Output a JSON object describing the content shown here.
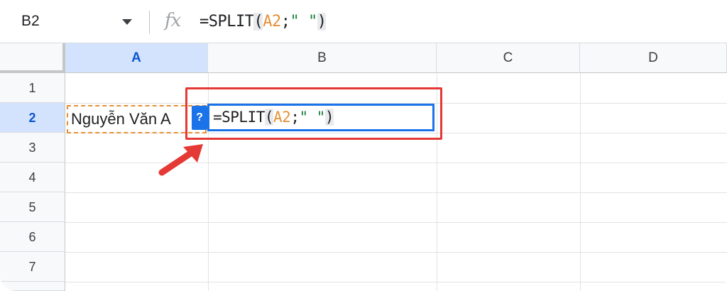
{
  "formula_bar": {
    "name_box": "B2",
    "fx_label": "fx",
    "formula_tokens": [
      {
        "text": "=SPLIT",
        "kind": "default"
      },
      {
        "text": "(",
        "kind": "paren"
      },
      {
        "text": "A2",
        "kind": "ref"
      },
      {
        "text": ";",
        "kind": "default"
      },
      {
        "text": "\" \"",
        "kind": "str"
      },
      {
        "text": ")",
        "kind": "paren"
      }
    ]
  },
  "grid": {
    "columns": [
      "A",
      "B",
      "C",
      "D"
    ],
    "selected_column": "A",
    "rows": [
      "1",
      "2",
      "3",
      "4",
      "5",
      "6",
      "7"
    ],
    "selected_row": "2",
    "cells": {
      "A2": "Nguyễn Văn A"
    }
  },
  "editor": {
    "help_badge": "?",
    "formula_tokens": [
      {
        "text": "=SPLIT",
        "kind": "default"
      },
      {
        "text": "(",
        "kind": "paren"
      },
      {
        "text": "A2",
        "kind": "ref"
      },
      {
        "text": ";",
        "kind": "default"
      },
      {
        "text": "\" \"",
        "kind": "str"
      },
      {
        "text": ")",
        "kind": "paren"
      }
    ]
  },
  "colors": {
    "accent": "#1a73e8",
    "reference": "#e69138",
    "string": "#188038",
    "annotation": "#e53935",
    "selected_header": "#d3e3fd"
  },
  "icons": {
    "dropdown": "chevron-down-icon",
    "function": "fx-icon",
    "annotation_arrow": "arrow-icon"
  }
}
